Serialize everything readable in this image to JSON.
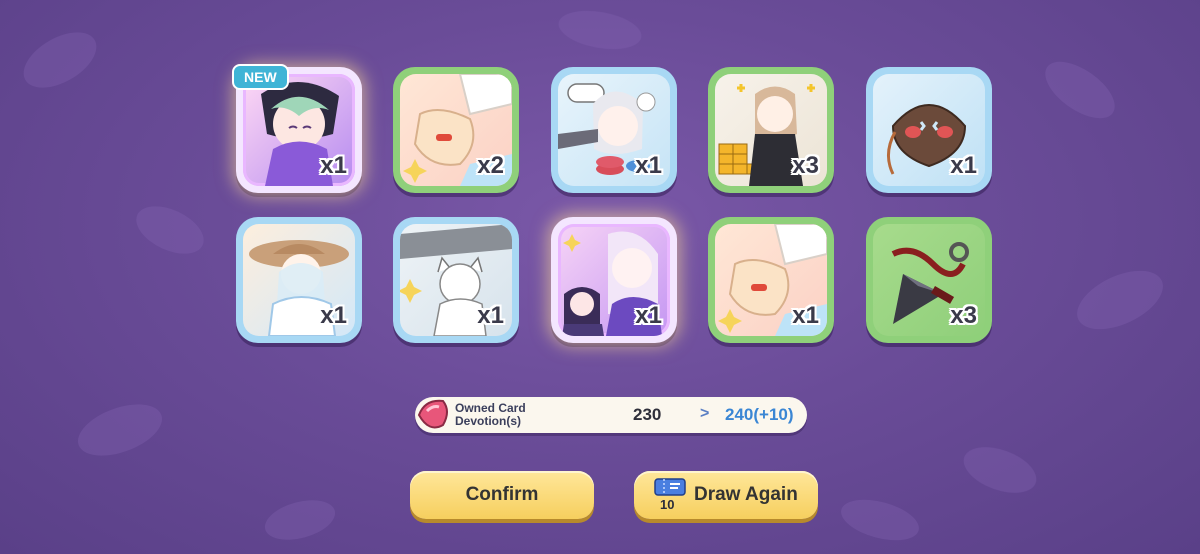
{
  "cards": [
    {
      "quantity": "x1",
      "rarity": "purple",
      "art": "maid-girl-art",
      "is_new": true
    },
    {
      "quantity": "x2",
      "rarity": "green",
      "art": "chef-hand-art",
      "is_new": false
    },
    {
      "quantity": "x1",
      "rarity": "blue",
      "art": "casino-girl-art",
      "is_new": false
    },
    {
      "quantity": "x3",
      "rarity": "green",
      "art": "gold-girl-art",
      "is_new": false
    },
    {
      "quantity": "x1",
      "rarity": "blue",
      "art": "mask-item-art",
      "is_new": false
    },
    {
      "quantity": "x1",
      "rarity": "blue",
      "art": "hat-girl-art",
      "is_new": false
    },
    {
      "quantity": "x1",
      "rarity": "blue",
      "art": "cat-girl-art",
      "is_new": false
    },
    {
      "quantity": "x1",
      "rarity": "purple",
      "art": "duo-girls-art",
      "is_new": false
    },
    {
      "quantity": "x1",
      "rarity": "green",
      "art": "chef-hand-art",
      "is_new": false
    },
    {
      "quantity": "x3",
      "rarity": "green",
      "art": "kunai-item-art",
      "is_new": false
    }
  ],
  "new_badge": "NEW",
  "devotion": {
    "label_line1": "Owned Card",
    "label_line2": "Devotion(s)",
    "current": "230",
    "arrow": ">",
    "new_value": "240(+10)"
  },
  "buttons": {
    "confirm": "Confirm",
    "draw_again": "Draw Again",
    "draw_cost": "10"
  },
  "colors": {
    "background": "#6a4c98",
    "rarity_green": "#8fd07a",
    "rarity_blue": "#a8d8f4",
    "rarity_purple": "#e9b7ff",
    "button": "#f6cf5e",
    "new_badge": "#3fb4d6"
  }
}
